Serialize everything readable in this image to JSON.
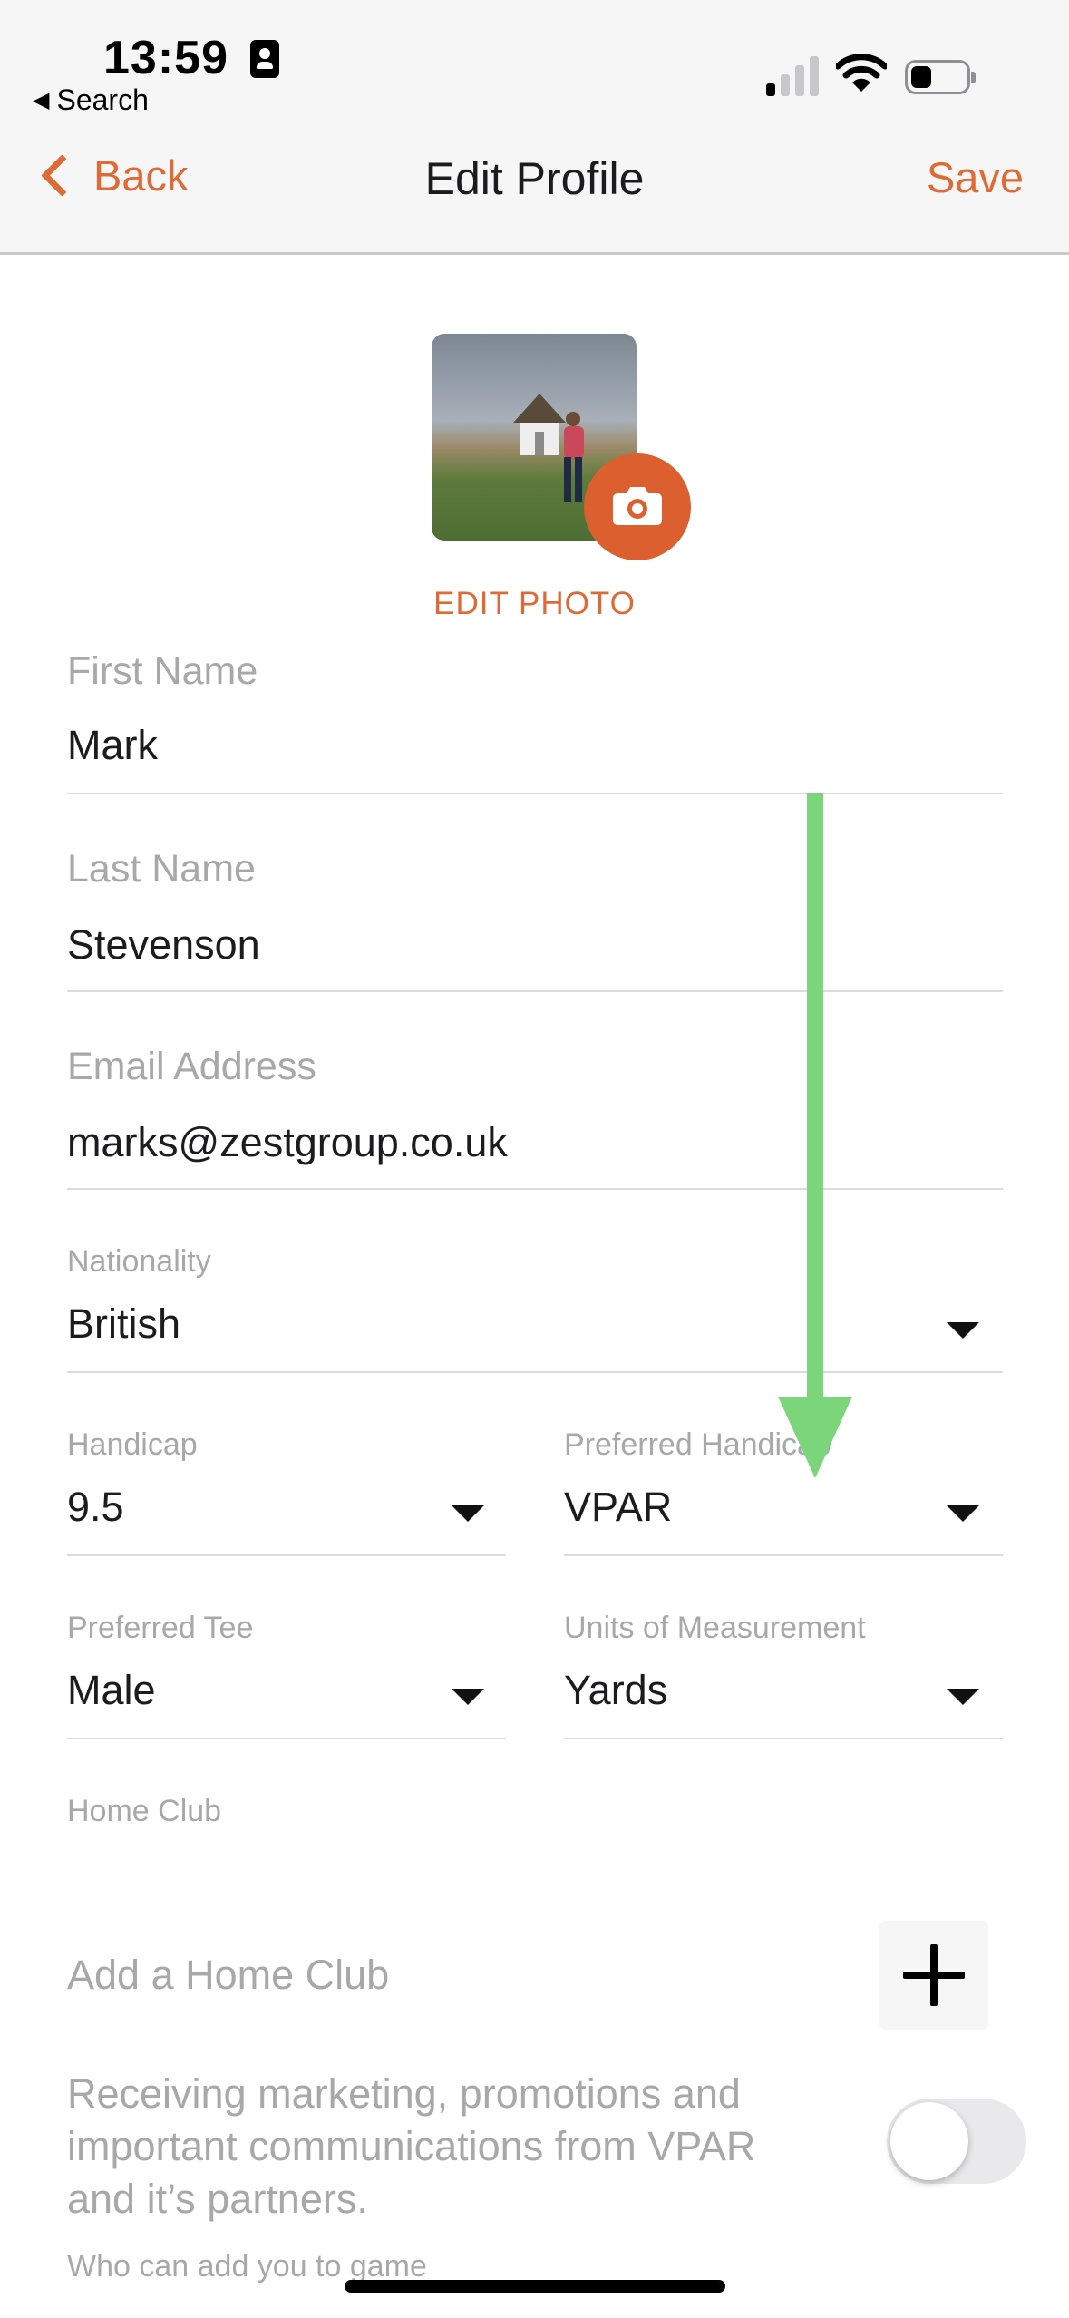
{
  "status_bar": {
    "time": "13:59",
    "back_app": "Search"
  },
  "nav": {
    "back_label": "Back",
    "title": "Edit Profile",
    "save_label": "Save"
  },
  "photo": {
    "edit_label": "EDIT PHOTO"
  },
  "fields": {
    "first_name": {
      "label": "First Name",
      "value": "Mark"
    },
    "last_name": {
      "label": "Last Name",
      "value": "Stevenson"
    },
    "email": {
      "label": "Email Address",
      "value": "marks@zestgroup.co.uk"
    },
    "nationality": {
      "label": "Nationality",
      "value": "British"
    },
    "handicap": {
      "label": "Handicap",
      "value": "9.5"
    },
    "preferred_handicap": {
      "label": "Preferred Handicap",
      "value": "VPAR"
    },
    "preferred_tee": {
      "label": "Preferred Tee",
      "value": "Male"
    },
    "units": {
      "label": "Units of Measurement",
      "value": "Yards"
    }
  },
  "home_club": {
    "label": "Home Club",
    "placeholder": "Add a Home Club"
  },
  "marketing": {
    "text": "Receiving marketing, promotions and important communications from VPAR and it’s partners.",
    "enabled": false
  },
  "who_can_add": {
    "label": "Who can add you to game"
  },
  "colors": {
    "accent": "#e06a35",
    "camera_button": "#dc5f2f",
    "annotation_arrow": "#7bd67b"
  }
}
